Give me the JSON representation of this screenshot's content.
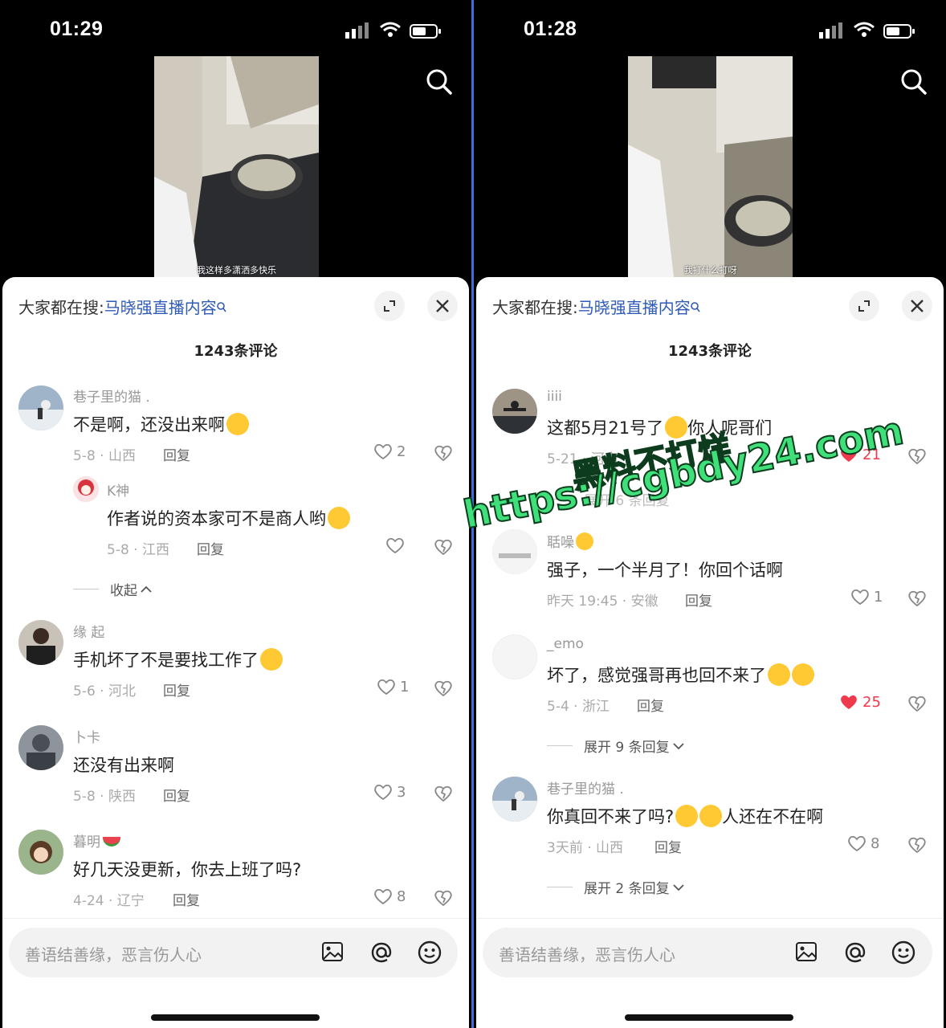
{
  "screens": [
    {
      "time": "01:29",
      "subtitle": "我这样多潇洒多快乐",
      "hot_search_prefix": "大家都在搜:",
      "hot_search_term": "马晓强直播内容",
      "comment_count": "1243条评论",
      "comments": [
        {
          "user": "巷子里的猫 .",
          "text": "不是啊，还没出来啊",
          "date": "5-8 · 山西",
          "reply": "回复",
          "likes": "2",
          "liked": false
        },
        {
          "user": "K神",
          "text": "作者说的资本家可不是商人哟",
          "date": "5-8 · 江西",
          "reply": "回复",
          "likes": "",
          "liked": false
        },
        {
          "user": "缘 起",
          "text": "手机坏了不是要找工作了",
          "date": "5-6 · 河北",
          "reply": "回复",
          "likes": "1",
          "liked": false
        },
        {
          "user": "卜卡",
          "text": "还没有出来啊",
          "date": "5-8 · 陕西",
          "reply": "回复",
          "likes": "3",
          "liked": false
        },
        {
          "user": "暮明",
          "text": "好几天没更新，你去上班了吗?",
          "date": "4-24 · 辽宁",
          "reply": "回复",
          "likes": "8",
          "liked": false
        }
      ],
      "collapse_label": "收起",
      "input_placeholder": "善语结善缘，恶言伤人心"
    },
    {
      "time": "01:28",
      "subtitle": "我打什么打呀",
      "hot_search_prefix": "大家都在搜:",
      "hot_search_term": "马晓强直播内容",
      "comment_count": "1243条评论",
      "comments": [
        {
          "user": "iiii",
          "text": "这都5月21号了",
          "text2": "你人呢哥们",
          "date": "5-21 · 河南",
          "reply": "回复",
          "likes": "21",
          "liked": true
        },
        {
          "user": "聒噪",
          "text": "强子，一个半月了！你回个话啊",
          "date": "昨天 19:45 · 安徽",
          "reply": "回复",
          "likes": "1",
          "liked": false
        },
        {
          "user": "_emo",
          "text": "坏了，感觉强哥再也回不来了",
          "date": "5-4 · 浙江",
          "reply": "回复",
          "likes": "25",
          "liked": true
        },
        {
          "user": "巷子里的猫 .",
          "text": "你真回不来了吗?",
          "text2": "人还在不在啊",
          "date": "3天前 · 山西",
          "reply": "回复",
          "likes": "8",
          "liked": false
        }
      ],
      "expand_1": "展开 9 条回复",
      "expand_2": "展开 2 条回复",
      "hidden_replies": "展开 6 条回复",
      "input_placeholder": "善语结善缘，恶言伤人心"
    }
  ],
  "watermark": {
    "line1": "黑料不打烊",
    "line2": "https://cgbdy24.com"
  },
  "colors": {
    "accent_link": "#2f5bb7",
    "like_red": "#ef3a4d",
    "watermark_green": "#3fe07a"
  }
}
